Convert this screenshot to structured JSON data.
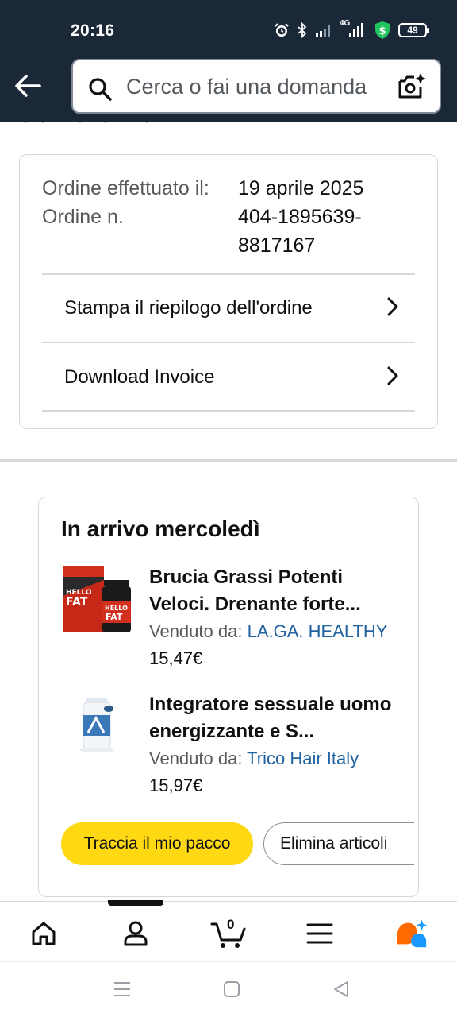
{
  "status_bar": {
    "time": "20:16",
    "network_label": "4G",
    "battery_level": "49",
    "icons": [
      "alarm-icon",
      "bluetooth-icon",
      "signal-icon",
      "signal-4g-icon",
      "shield-dollar-icon",
      "battery-icon"
    ]
  },
  "header": {
    "back_icon": "back-arrow-icon",
    "search_placeholder": "Cerca o fai una domanda",
    "search_icon": "search-icon",
    "camera_icon": "camera-icon"
  },
  "page": {
    "cropped_heading": "dell'ordine"
  },
  "order_info": {
    "date_label": "Ordine effettuato il:",
    "date_value": "19 aprile 2025",
    "number_label": "Ordine n.",
    "number_value": "404-1895639-8817167",
    "rows": [
      {
        "label": "Stampa il riepilogo dell'ordine",
        "icon": "chevron-right-icon"
      },
      {
        "label": "Download Invoice",
        "icon": "chevron-right-icon"
      }
    ]
  },
  "arrival": {
    "title": "In arrivo mercoledì",
    "seller_prefix": "Venduto da:",
    "products": [
      {
        "name": "Brucia Grassi Potenti Veloci. Drenante forte...",
        "seller": "LA.GA. HEALTHY",
        "price": "15,47€",
        "image_text": "HELLO FAT"
      },
      {
        "name": "Integratore sessuale uomo energizzante e S...",
        "seller": "Trico Hair Italy",
        "price": "15,97€",
        "image_text": ""
      }
    ],
    "track_button": "Traccia il mio pacco",
    "delete_button": "Elimina articoli"
  },
  "bottom_nav": {
    "items": [
      "home-icon",
      "account-icon",
      "cart-icon",
      "menu-icon",
      "rufus-icon"
    ],
    "cart_count": "0"
  },
  "system_nav": {
    "items": [
      "recents-icon",
      "home-square-icon",
      "back-triangle-icon"
    ]
  },
  "colors": {
    "header_bg": "#1b2838",
    "primary_button": "#ffd814",
    "link": "#2162a1",
    "rufus_orange": "#ff6a00",
    "rufus_blue": "#1a98ff"
  }
}
